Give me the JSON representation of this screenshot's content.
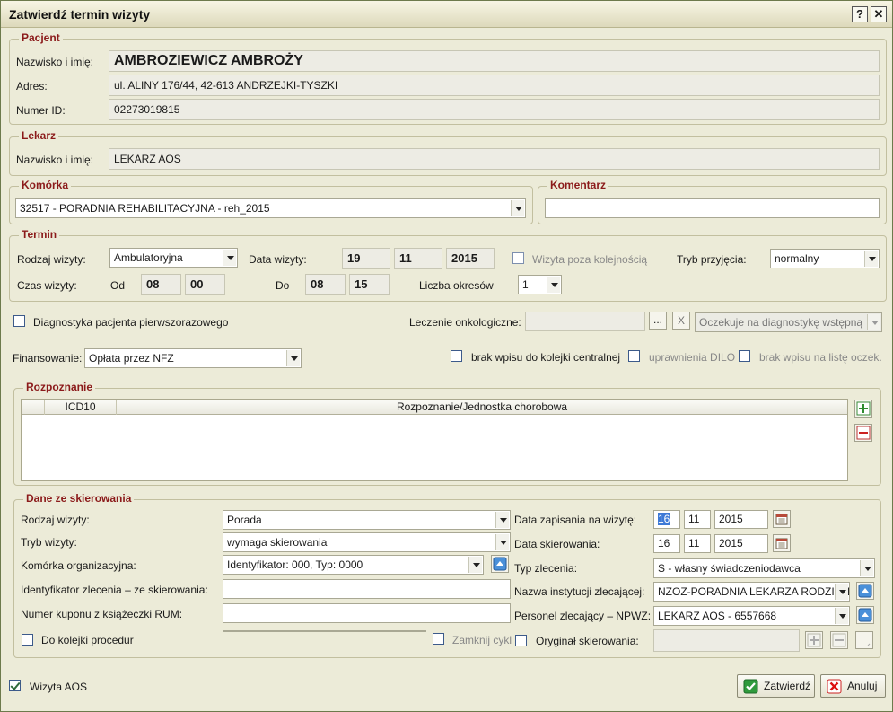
{
  "window": {
    "title": "Zatwierdź termin wizyty",
    "help": "?",
    "close": "✕"
  },
  "patient": {
    "legend": "Pacjent",
    "name_label": "Nazwisko i imię:",
    "name": "AMBROZIEWICZ AMBROŻY",
    "address_label": "Adres:",
    "address": "ul. ALINY 176/44, 42-613 ANDRZEJKI-TYSZKI",
    "id_label": "Numer ID:",
    "id": "02273019815"
  },
  "doctor": {
    "legend": "Lekarz",
    "name_label": "Nazwisko i imię:",
    "name": "LEKARZ AOS"
  },
  "unit": {
    "legend": "Komórka",
    "value": "32517 - PORADNIA REHABILITACYJNA - reh_2015"
  },
  "comment": {
    "legend": "Komentarz",
    "value": ""
  },
  "term": {
    "legend": "Termin",
    "visit_type_label": "Rodzaj wizyty:",
    "visit_type": "Ambulatoryjna",
    "date_label": "Data wizyty:",
    "day": "19",
    "month": "11",
    "year": "2015",
    "out_of_order_label": "Wizyta poza kolejnością",
    "admission_label": "Tryb przyjęcia:",
    "admission": "normalny",
    "time_label": "Czas wizyty:",
    "from_label": "Od",
    "from_h": "08",
    "from_m": "00",
    "to_label": "Do",
    "to_h": "08",
    "to_m": "15",
    "periods_label": "Liczba okresów",
    "periods": "1"
  },
  "diag_first_label": "Diagnostyka pacjenta pierwszorazowego",
  "oncology": {
    "label": "Leczenie onkologiczne:",
    "value": "",
    "dots": "...",
    "clear": "X",
    "status": "Oczekuje na diagnostykę wstępną"
  },
  "financing": {
    "label": "Finansowanie:",
    "value": "Opłata przez NFZ"
  },
  "flags": {
    "central_queue": "brak wpisu do kolejki centralnej",
    "dilo": "uprawnienia DILO",
    "waiting_list": "brak wpisu na listę oczek."
  },
  "diagnosis": {
    "legend": "Rozpoznanie",
    "columns": [
      "ICD10",
      "Rozpoznanie/Jednostka chorobowa"
    ]
  },
  "referral": {
    "legend": "Dane ze skierowania",
    "visit_type_label": "Rodzaj wizyty:",
    "visit_type": "Porada",
    "visit_mode_label": "Tryb wizyty:",
    "visit_mode": "wymaga skierowania",
    "org_unit_label": "Komórka organizacyjna:",
    "org_unit": "Identyfikator: 000, Typ: 0000",
    "order_id_label": "Identyfikator zlecenia – ze skierowania:",
    "order_id": "",
    "coupon_label": "Numer kuponu z książeczki RUM:",
    "coupon": "",
    "procedure_queue_label": "Do kolejki procedur",
    "procedure_queue": "",
    "close_cycle_label": "Zamknij cykl",
    "reg_date_label": "Data zapisania na wizytę:",
    "reg_day": "16",
    "reg_month": "11",
    "reg_year": "2015",
    "ref_date_label": "Data skierowania:",
    "ref_day": "16",
    "ref_month": "11",
    "ref_year": "2015",
    "order_type_label": "Typ zlecenia:",
    "order_type": "S - własny świadczeniodawca",
    "institution_label": "Nazwa instytucji zlecającej:",
    "institution": "NZOZ-PORADNIA LEKARZA RODZINNEGO",
    "staff_label": "Personel zlecający – NPWZ:",
    "staff": "LEKARZ AOS - 6557668",
    "original_label": "Oryginał skierowania:",
    "original": ""
  },
  "footer": {
    "aos_label": "Wizyta AOS",
    "confirm": "Zatwierdź",
    "cancel": "Anuluj"
  }
}
